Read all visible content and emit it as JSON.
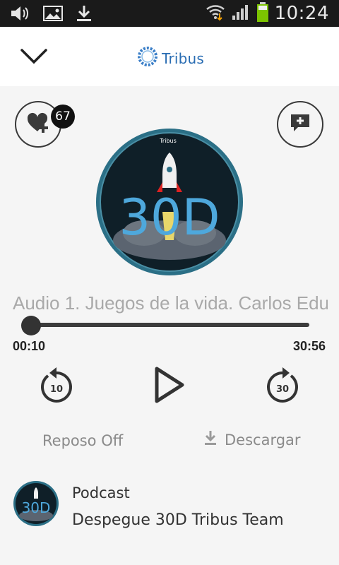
{
  "status_bar": {
    "time": "10:24",
    "icons": [
      "volume-icon",
      "gallery-icon",
      "download-icon",
      "wifi-icon",
      "signal-icon",
      "battery-icon"
    ]
  },
  "header": {
    "brand": "Tribus",
    "collapse_icon": "chevron-down-icon"
  },
  "player": {
    "likes_count": "67",
    "track_title": "Audio 1. Juegos de la vida. Carlos Edu",
    "current_time": "00:10",
    "total_time": "30:56",
    "progress": 0.005,
    "rewind_seconds": "10",
    "forward_seconds": "30",
    "sleep_label": "Reposo Off",
    "download_label": "Descargar",
    "artwork_text": "30D"
  },
  "podcast": {
    "kind_label": "Podcast",
    "name": "Despegue 30D Tribus Team"
  },
  "colors": {
    "accent_blue": "#2a6db3",
    "artwork_ring": "#2b6f86",
    "text_muted": "#a9a9a9",
    "dark": "#333333"
  }
}
